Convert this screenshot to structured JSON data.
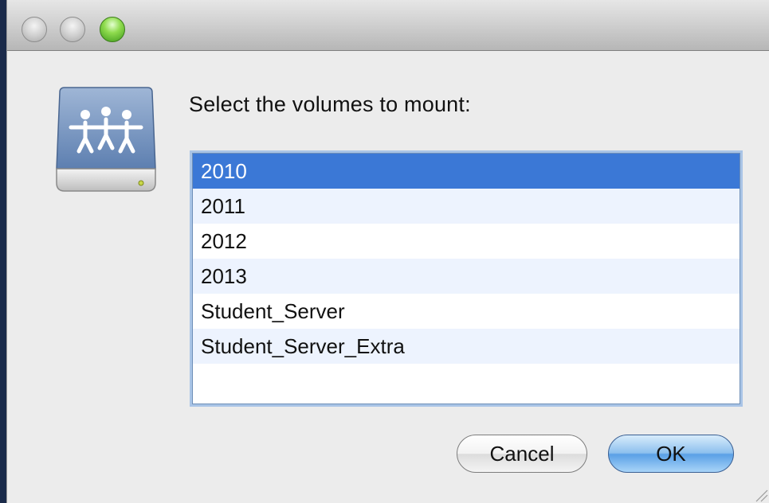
{
  "window": {
    "title": ""
  },
  "dialog": {
    "prompt": "Select the volumes to mount:",
    "icon": "shared-server-drive-icon",
    "volumes": [
      {
        "label": "2010",
        "selected": true
      },
      {
        "label": "2011",
        "selected": false
      },
      {
        "label": "2012",
        "selected": false
      },
      {
        "label": "2013",
        "selected": false
      },
      {
        "label": "Student_Server",
        "selected": false
      },
      {
        "label": "Student_Server_Extra",
        "selected": false
      }
    ],
    "buttons": {
      "cancel": "Cancel",
      "ok": "OK"
    }
  },
  "colors": {
    "selection": "#3b78d6",
    "alt_row": "#edf3fe",
    "default_button": "#5aa0e6"
  }
}
